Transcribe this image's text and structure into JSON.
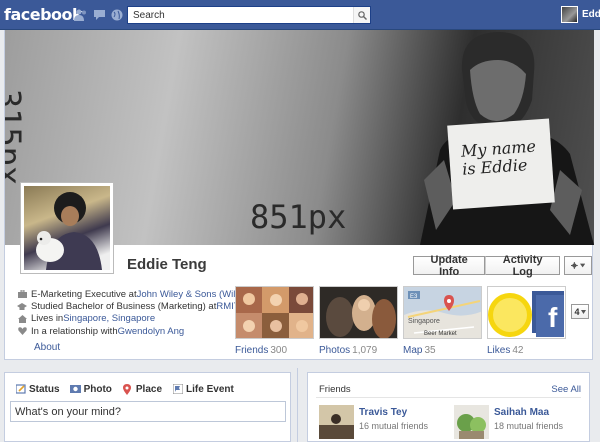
{
  "topbar": {
    "logo": "facebook",
    "search_placeholder": "Search",
    "user_name": "Eddie"
  },
  "cover": {
    "width_label": "851px",
    "height_label": "315px",
    "sign_line1": "My name",
    "sign_line2": "is Eddie"
  },
  "profile": {
    "name": "Eddie Teng"
  },
  "actions": {
    "update_info": "Update Info",
    "activity_log": "Activity Log"
  },
  "about": {
    "items": [
      {
        "prefix": "E-Marketing Executive at ",
        "link": "John Wiley & Sons (Wile..."
      },
      {
        "prefix": "Studied Bachelor of Business (Marketing) at ",
        "link": "RMIT..."
      },
      {
        "prefix": "Lives in ",
        "link": "Singapore, Singapore"
      },
      {
        "prefix": "In a relationship with ",
        "link": "Gwendolyn Ang"
      }
    ],
    "link_label": "About"
  },
  "apps": [
    {
      "label": "Friends",
      "count": "300"
    },
    {
      "label": "Photos",
      "count": "1,079"
    },
    {
      "label": "Map",
      "count": "35"
    },
    {
      "label": "Likes",
      "count": "42"
    }
  ],
  "map_labels": {
    "e3": "E3",
    "city": "Singapore",
    "market": "Beer Market"
  },
  "more_count": "4",
  "composer": {
    "tabs": [
      "Status",
      "Photo",
      "Place",
      "Life Event"
    ],
    "placeholder": "What's on your mind?"
  },
  "friends_box": {
    "title": "Friends",
    "see_all": "See All",
    "people": [
      {
        "name": "Travis Tey",
        "mutual": "16 mutual friends"
      },
      {
        "name": "Saihah Maa",
        "mutual": "18 mutual friends"
      }
    ]
  }
}
